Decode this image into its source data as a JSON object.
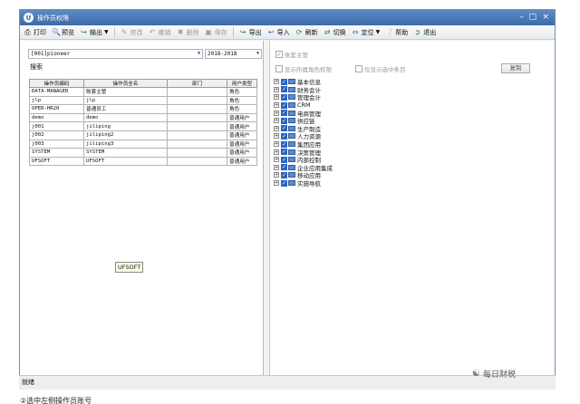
{
  "window": {
    "title": "操作员权限"
  },
  "toolbar": {
    "items": [
      {
        "label": "打印",
        "icon": "printer-icon"
      },
      {
        "label": "预览",
        "icon": "preview-icon"
      },
      {
        "label": "输出",
        "icon": "export-icon"
      },
      {
        "label": "修改",
        "icon": "pencil-icon"
      },
      {
        "label": "撤销",
        "icon": "undo-icon"
      },
      {
        "label": "删除",
        "icon": "delete-icon"
      },
      {
        "label": "保存",
        "icon": "save-icon"
      },
      {
        "label": "导出",
        "icon": "export-icon"
      },
      {
        "label": "导入",
        "icon": "import-icon"
      },
      {
        "label": "刷新",
        "icon": "refresh-icon"
      },
      {
        "label": "切换",
        "icon": "switch-icon"
      },
      {
        "label": "定位",
        "icon": "locate-icon"
      },
      {
        "label": "帮助",
        "icon": "help-icon"
      },
      {
        "label": "退出",
        "icon": "exit-icon"
      }
    ]
  },
  "left": {
    "account_select": "[001]pioneer",
    "year_select": "2018-2018",
    "search_label": "搜索",
    "columns": [
      "操作员编码",
      "操作员全名",
      "部门",
      "用户类型"
    ],
    "rows": [
      [
        "DATA-MANAGER",
        "账套主管",
        "",
        "角色"
      ],
      [
        "jlp",
        "jlp",
        "",
        "角色"
      ],
      [
        "OPER-HR20",
        "普通员工",
        "",
        "角色"
      ],
      [
        "demo",
        "demo",
        "",
        "普通用户"
      ],
      [
        "j001",
        "jiliping",
        "",
        "普通用户"
      ],
      [
        "j002",
        "jiliping2",
        "",
        "普通用户"
      ],
      [
        "j003",
        "jiliping3",
        "",
        "普通用户"
      ],
      [
        "SYSTEM",
        "SYSTEM",
        "",
        "普通用户"
      ],
      [
        "UFSOFT",
        "UFSOFT",
        "",
        "普通用户"
      ]
    ],
    "tooltip": "UFSOFT"
  },
  "right": {
    "supervisor_label": "账套主管",
    "show_role_perms_label": "显示所属角色权限",
    "only_selected_label": "仅显示选中条目",
    "copy_label": "复制",
    "tree": [
      "基本信息",
      "财务会计",
      "管理会计",
      "CRM",
      "电商管理",
      "供应链",
      "生产制造",
      "人力资源",
      "集团应用",
      "决策管理",
      "内部控制",
      "企业应用集成",
      "移动应用",
      "实施导航"
    ]
  },
  "status": "就绪",
  "watermark": "每日财税",
  "caption": "②选中左侧操作员账号"
}
